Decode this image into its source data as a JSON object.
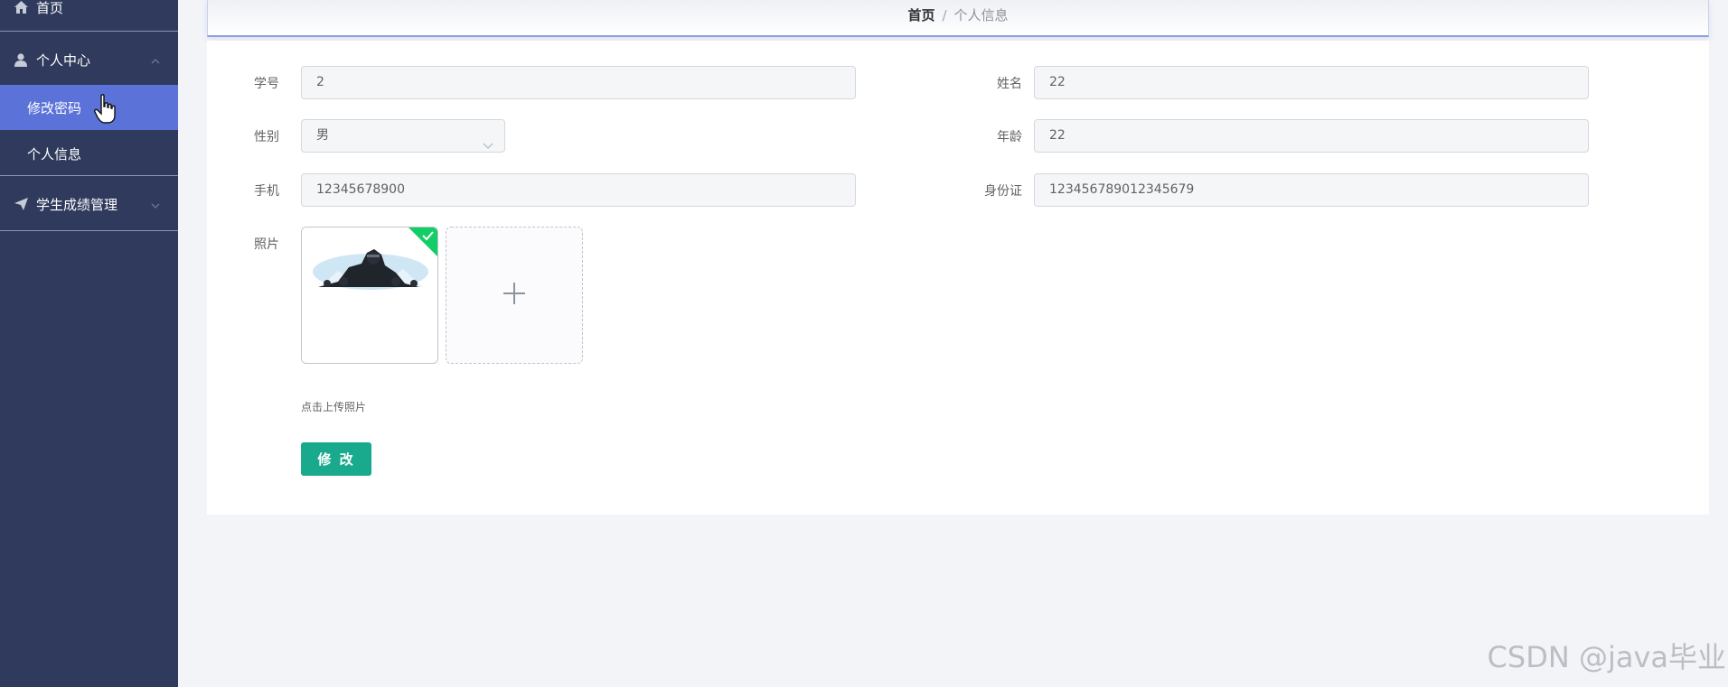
{
  "sidebar": {
    "items": [
      {
        "label": "首页",
        "icon": "home-icon"
      },
      {
        "label": "个人中心",
        "icon": "user-icon",
        "expanded": true
      },
      {
        "label": "修改密码",
        "active": true
      },
      {
        "label": "个人信息"
      },
      {
        "label": "学生成绩管理",
        "icon": "send-icon"
      }
    ]
  },
  "breadcrumb": {
    "home": "首页",
    "separator": "/",
    "current": "个人信息"
  },
  "form": {
    "student_id": {
      "label": "学号",
      "value": "2"
    },
    "name": {
      "label": "姓名",
      "value": "22"
    },
    "gender": {
      "label": "性别",
      "value": "男"
    },
    "age": {
      "label": "年龄",
      "value": "22"
    },
    "phone": {
      "label": "手机",
      "value": "12345678900"
    },
    "id_card": {
      "label": "身份证",
      "value": "123456789012345679"
    },
    "photo": {
      "label": "照片",
      "hint": "点击上传照片"
    },
    "submit_label": "修 改"
  },
  "colors": {
    "sidebar_bg": "#2f3a5c",
    "active_item": "#5b72d9",
    "primary_button": "#19aa8d",
    "header_border": "#8a9fe0"
  },
  "watermark": "CSDN @java毕业"
}
